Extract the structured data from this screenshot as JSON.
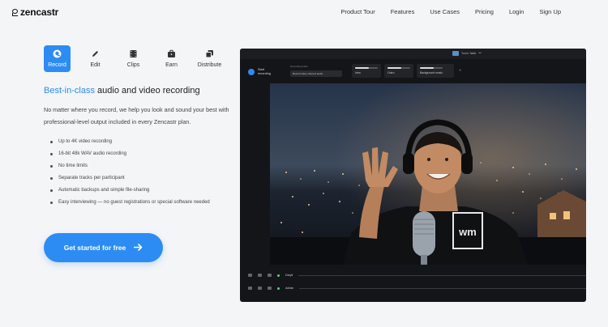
{
  "brand": {
    "name": "zencastr"
  },
  "nav": {
    "links": [
      "Product Tour",
      "Features",
      "Use Cases",
      "Pricing",
      "Login",
      "Sign Up"
    ]
  },
  "tabs": [
    {
      "label": "Record",
      "icon": "mic-icon",
      "active": true
    },
    {
      "label": "Edit",
      "icon": "pencil-icon",
      "active": false
    },
    {
      "label": "Clips",
      "icon": "film-icon",
      "active": false
    },
    {
      "label": "Earn",
      "icon": "briefcase-icon",
      "active": false
    },
    {
      "label": "Distribute",
      "icon": "layers-icon",
      "active": false
    }
  ],
  "hero": {
    "headline_highlight": "Best-in-class",
    "headline_rest": " audio and video recording",
    "description": "No matter where you record, we help you look and sound your best with professional-level output included in every Zencastr plan.",
    "features": [
      "Up to 4K video recording",
      "16-bit 48k WAV audio recording",
      "No time limits",
      "Separate tracks per participant",
      "Automatic backups and simple file-sharing",
      "Easy interviewing — no guest registrations or special software needed"
    ],
    "cta_label": "Get started for free"
  },
  "app": {
    "room_title": "Tom's Table",
    "start_recording": "Start recording",
    "folder_label": "Recording folder",
    "folder_value": "Record video, Record audio",
    "tracks": [
      "Intro",
      "Outro",
      "Background music"
    ],
    "participants": [
      "Daryll",
      "Adrian"
    ]
  },
  "colors": {
    "accent": "#2c8cf4",
    "app_bg": "#141518"
  }
}
